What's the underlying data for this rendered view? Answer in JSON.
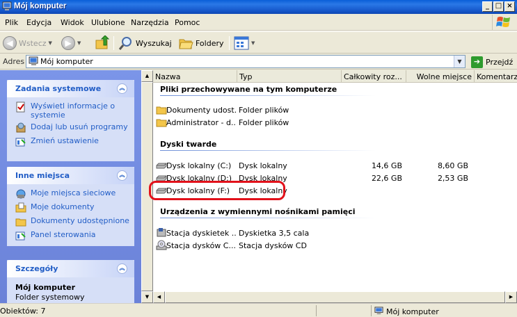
{
  "window": {
    "title": "Mój komputer"
  },
  "menu": [
    "Plik",
    "Edycja",
    "Widok",
    "Ulubione",
    "Narzędzia",
    "Pomoc"
  ],
  "toolbar": {
    "back_label": "Wstecz",
    "search_label": "Wyszukaj",
    "folders_label": "Foldery"
  },
  "address": {
    "label": "Adres",
    "value": "Mój komputer",
    "go_label": "Przejdź"
  },
  "sidebar": {
    "panels": [
      {
        "title": "Zadania systemowe",
        "items": [
          "Wyświetl informacje o systemie",
          "Dodaj lub usuń programy",
          "Zmień ustawienie"
        ]
      },
      {
        "title": "Inne miejsca",
        "items": [
          "Moje miejsca sieciowe",
          "Moje dokumenty",
          "Dokumenty udostępnione",
          "Panel sterowania"
        ]
      },
      {
        "title": "Szczegóły",
        "detail_title": "Mój komputer",
        "detail_sub": "Folder systemowy"
      }
    ]
  },
  "columns": [
    "Nazwa",
    "Typ",
    "Całkowity roz...",
    "Wolne miejsce",
    "Komentarze"
  ],
  "groups": [
    {
      "title": "Pliki przechowywane na tym komputerze",
      "rows": [
        {
          "name": "Dokumenty udost...",
          "type": "Folder plików",
          "total": "",
          "free": "",
          "icon": "folder-icon"
        },
        {
          "name": "Administrator - d...",
          "type": "Folder plików",
          "total": "",
          "free": "",
          "icon": "folder-icon"
        }
      ]
    },
    {
      "title": "Dyski twarde",
      "rows": [
        {
          "name": "Dysk lokalny (C:)",
          "type": "Dysk lokalny",
          "total": "14,6 GB",
          "free": "8,60 GB",
          "icon": "hard-drive-icon"
        },
        {
          "name": "Dysk lokalny (D:)",
          "type": "Dysk lokalny",
          "total": "22,6 GB",
          "free": "2,53 GB",
          "icon": "hard-drive-icon"
        },
        {
          "name": "Dysk lokalny (F:)",
          "type": "Dysk lokalny",
          "total": "",
          "free": "",
          "icon": "hard-drive-icon"
        }
      ]
    },
    {
      "title": "Urządzenia z wymiennymi nośnikami pamięci",
      "rows": [
        {
          "name": "Stacja dyskietek ...",
          "type": "Dyskietka 3,5 cala",
          "total": "",
          "free": "",
          "icon": "floppy-drive-icon"
        },
        {
          "name": "Stacja dysków C...",
          "type": "Stacja dysków CD",
          "total": "",
          "free": "",
          "icon": "cd-drive-icon"
        }
      ]
    }
  ],
  "status": {
    "objects": "Obiektów: 7",
    "location": "Mój komputer"
  },
  "colors": {
    "title_bar": "#1455c8",
    "task_pane": "#6b82d8",
    "link": "#215dc6",
    "highlight": "#e2111a"
  }
}
